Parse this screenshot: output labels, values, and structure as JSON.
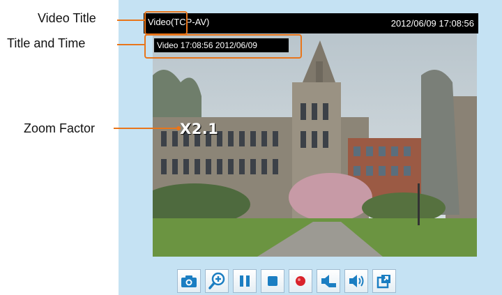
{
  "player": {
    "title_prefix": "Video",
    "title_suffix": "(TCP-AV)",
    "timestamp": "2012/06/09  17:08:56",
    "overlay_text": "Video 17:08:56  2012/06/09",
    "zoom_factor": "X2.1"
  },
  "annotations": {
    "video_title": "Video Title",
    "title_and_time": "Title and Time",
    "zoom_factor": "Zoom Factor"
  },
  "toolbar": {
    "buttons": [
      {
        "icon": "camera-icon"
      },
      {
        "icon": "zoom-in-icon"
      },
      {
        "icon": "pause-icon"
      },
      {
        "icon": "stop-icon"
      },
      {
        "icon": "record-icon"
      },
      {
        "icon": "volume-mute-icon"
      },
      {
        "icon": "volume-icon"
      },
      {
        "icon": "fullscreen-icon"
      }
    ]
  },
  "colors": {
    "panel_bg": "#c5e2f3",
    "callout": "#e8751a",
    "icon_blue": "#1b7ec2",
    "record_red": "#d9222a"
  }
}
